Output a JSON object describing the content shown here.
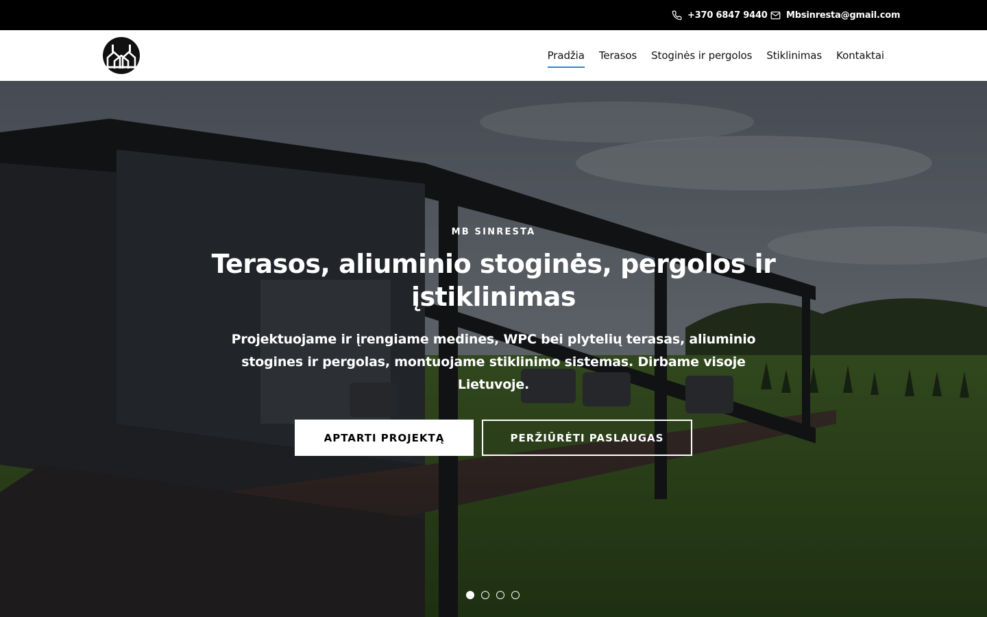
{
  "topbar": {
    "phone": "+370 6847 9440",
    "email": "Mbsinresta@gmail.com",
    "phone_icon": "phone-icon",
    "email_icon": "envelope-icon"
  },
  "header": {
    "nav": [
      {
        "label": "Pradžia",
        "active": true
      },
      {
        "label": "Terasos"
      },
      {
        "label": "Stoginės ir pergolos"
      },
      {
        "label": "Stiklinimas"
      },
      {
        "label": "Kontaktai"
      }
    ],
    "accent": "#1e88e5"
  },
  "hero": {
    "eyebrow": "MB SINRESTA",
    "title": "Terasos, aliuminio stoginės, pergolos ir įstiklinimas",
    "subtitle": "Projektuojame ir įrengiame medines, WPC bei plytelių terasas, aliuminio stogines ir pergolas, montuojame stiklinimo sistemas. Dirbame visoje Lietuvoje.",
    "primary_cta": "APTARTI PROJEKTĄ",
    "secondary_cta": "PERŽIŪRĖTI PASLAUGAS",
    "slides_total": 4,
    "current_slide": 1
  }
}
